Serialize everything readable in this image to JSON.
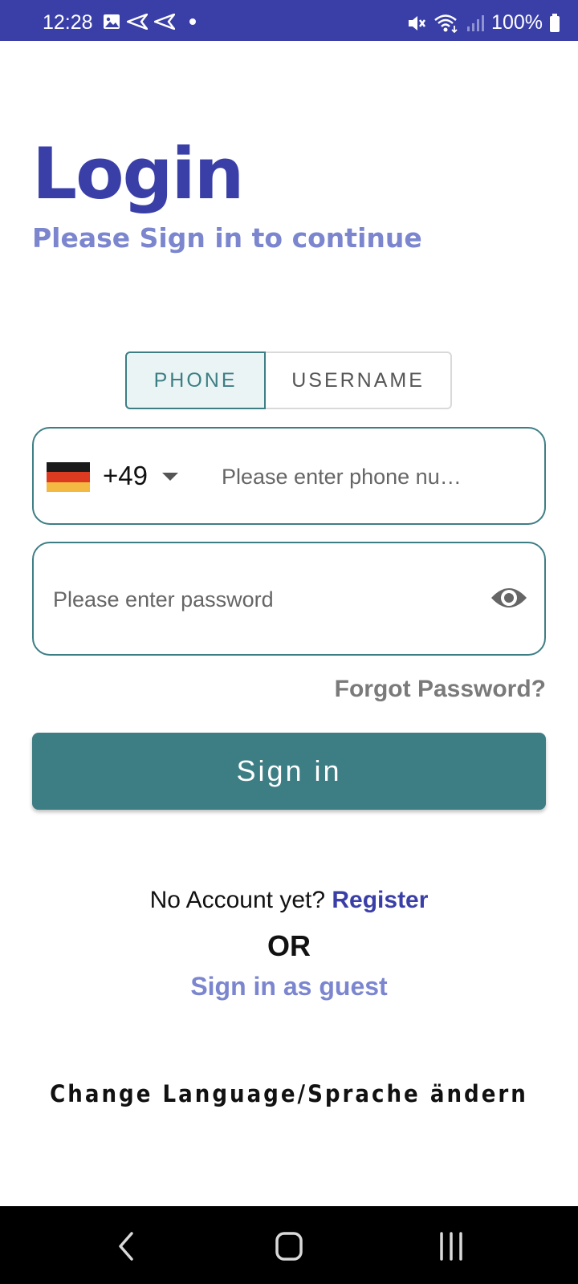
{
  "status_bar": {
    "time": "12:28",
    "battery": "100%",
    "left_icons": [
      "image-icon",
      "send-icon",
      "send-icon",
      "dot-icon"
    ],
    "right_icons": [
      "mute-icon",
      "wifi-icon",
      "signal-icon",
      "battery-icon"
    ]
  },
  "header": {
    "title": "Login",
    "subtitle": "Please Sign in to continue"
  },
  "login_mode": {
    "tabs": [
      {
        "label": "PHONE",
        "selected": true
      },
      {
        "label": "USERNAME",
        "selected": false
      }
    ]
  },
  "phone": {
    "country_flag": "germany-flag-icon",
    "country_code": "+49",
    "placeholder": "Please enter phone nu…"
  },
  "password": {
    "placeholder": "Please enter password",
    "toggle_icon": "eye-icon"
  },
  "forgot_password": "Forgot Password?",
  "sign_in_button": "Sign in",
  "register": {
    "prompt": "No Account yet?",
    "link": "Register"
  },
  "or_text": "OR",
  "guest_link": "Sign in as guest",
  "language_link": "Change Language/Sprache ändern",
  "colors": {
    "primary": "#3a3fa8",
    "secondary": "#7b86cf",
    "teal": "#3d7e84"
  },
  "nav_bar": {
    "buttons": [
      "back-icon",
      "home-icon",
      "recent-apps-icon"
    ]
  }
}
